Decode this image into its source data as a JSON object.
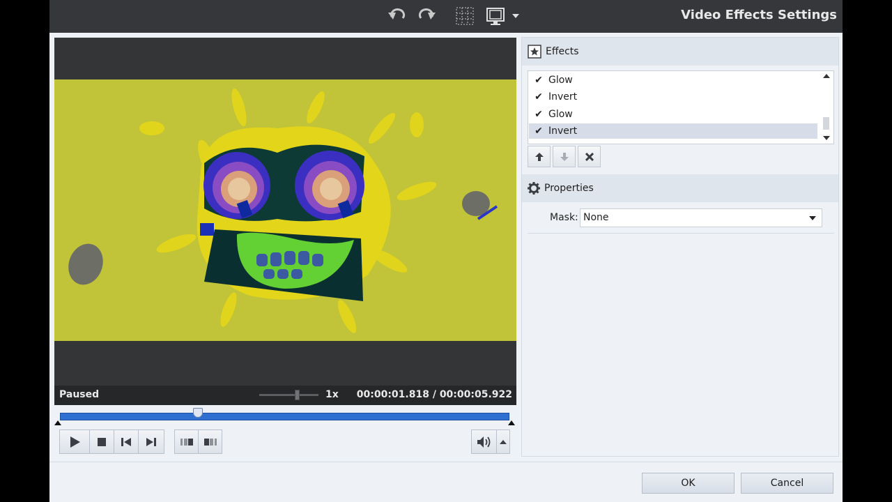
{
  "window": {
    "title": "Video Effects Settings"
  },
  "toolbar": {
    "icons": [
      "undo-icon",
      "redo-icon",
      "grid-icon",
      "display-mode-icon",
      "chevron-down-icon"
    ]
  },
  "player": {
    "status": "Paused",
    "speed": "1x",
    "time": "00:00:01.818 / 00:00:05.922",
    "seek_progress": 0.307,
    "buttons": [
      "play-icon",
      "stop-icon",
      "previous-frame-icon",
      "next-frame-icon",
      "mark-in-icon",
      "mark-out-icon"
    ],
    "volume_icon": "speaker-icon"
  },
  "effects": {
    "header": "Effects",
    "items": [
      {
        "label": "Glow",
        "checked": true,
        "selected": false
      },
      {
        "label": "Invert",
        "checked": true,
        "selected": false
      },
      {
        "label": "Glow",
        "checked": true,
        "selected": false
      },
      {
        "label": "Invert",
        "checked": true,
        "selected": true
      }
    ],
    "buttons": [
      "move-up-icon",
      "move-down-icon",
      "delete-icon"
    ]
  },
  "properties": {
    "header": "Properties",
    "mask_label": "Mask:",
    "mask_value": "None"
  },
  "dialog": {
    "ok_label": "OK",
    "cancel_label": "Cancel"
  },
  "colors": {
    "title_bar": "#35373a",
    "seek_bar": "#2f6fd1",
    "video_bg": "#c6c43a"
  }
}
